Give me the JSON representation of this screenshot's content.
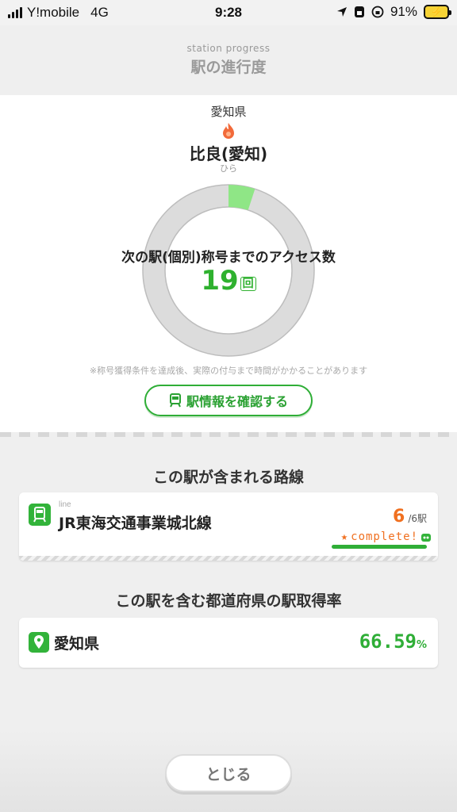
{
  "status_bar": {
    "carrier": "Y!mobile",
    "network": "4G",
    "time": "9:28",
    "battery": "91%"
  },
  "header": {
    "subtitle": "station progress",
    "title": "駅の進行度"
  },
  "station": {
    "prefecture": "愛知県",
    "name": "比良(愛知)",
    "kana": "ひら",
    "progress_label": "次の駅(個別)称号までのアクセス数",
    "remaining_count": "19",
    "remaining_unit": "回",
    "progress_fraction": 0.05,
    "note": "※称号獲得条件を達成後、実際の付与まで時間がかかることがあります",
    "info_button": "駅情報を確認する"
  },
  "lines_section": {
    "title": "この駅が含まれる路線",
    "items": [
      {
        "tag": "line",
        "name": "JR東海交通事業城北線",
        "acquired": "6",
        "total": "/6駅",
        "badge": "complete!"
      }
    ]
  },
  "pref_section": {
    "title": "この駅を含む都道府県の駅取得率",
    "name": "愛知県",
    "rate": "66.59",
    "rate_unit": "%"
  },
  "close_button": "とじる",
  "colors": {
    "accent_green": "#2fae37",
    "orange": "#f07020",
    "ring_gray": "#dcdcdc"
  }
}
